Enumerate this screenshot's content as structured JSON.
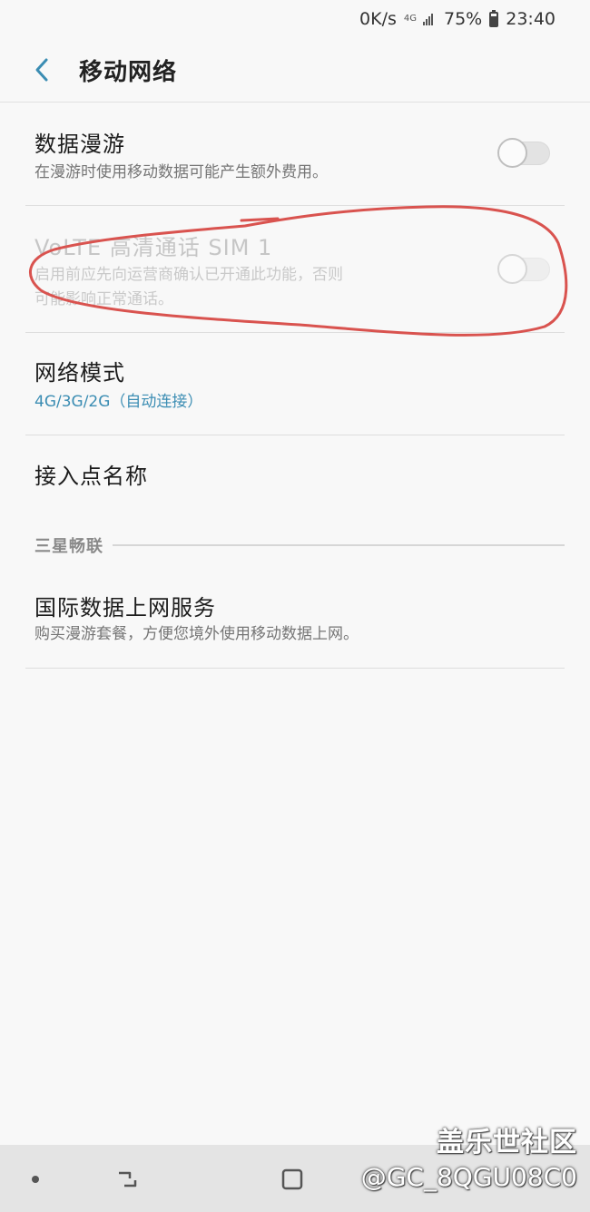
{
  "status_bar": {
    "network_speed": "0K/s",
    "network_type": "4G",
    "battery": "75%",
    "time": "23:40"
  },
  "app_bar": {
    "title": "移动网络",
    "back_icon": "chevron-left-icon"
  },
  "settings": [
    {
      "title": "数据漫游",
      "subtitle": "在漫游时使用移动数据可能产生额外费用。",
      "toggle": false,
      "enabled": true
    },
    {
      "title": "VoLTE 高清通话 SIM 1",
      "subtitle_line1": "启用前应先向运营商确认已开通此功能，否则",
      "subtitle_line2": "可能影响正常通话。",
      "toggle": false,
      "enabled": false
    },
    {
      "title": "网络模式",
      "subtitle": "4G/3G/2G（自动连接）"
    },
    {
      "title": "接入点名称"
    }
  ],
  "section": {
    "label": "三星畅联",
    "items": [
      {
        "title": "国际数据上网服务",
        "subtitle": "购买漫游套餐，方便您境外使用移动数据上网。"
      }
    ]
  },
  "watermark": {
    "site": "盖乐世社区",
    "user": "@GC_8QGU08C0"
  },
  "colors": {
    "accent": "#3b8db3",
    "annotation": "#d9534f",
    "background": "#f8f8f8"
  }
}
